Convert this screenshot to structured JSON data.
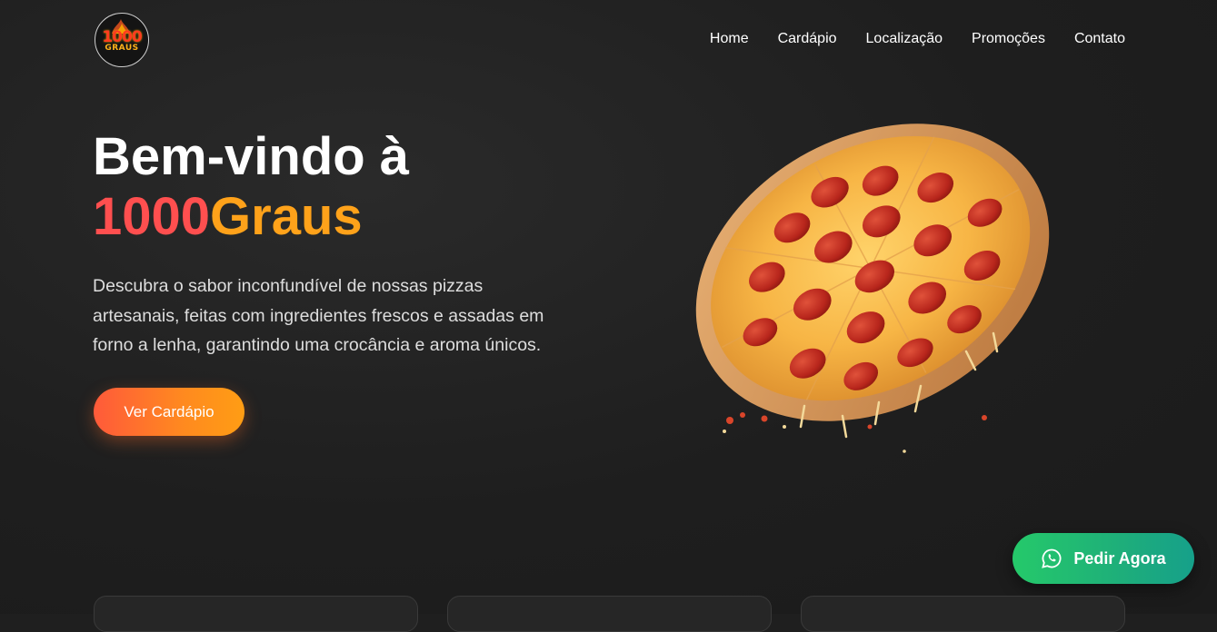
{
  "header": {
    "logo": {
      "number": "1000",
      "word": "GRAUS"
    },
    "nav": [
      "Home",
      "Cardápio",
      "Localização",
      "Promoções",
      "Contato"
    ]
  },
  "hero": {
    "title_line1": "Bem-vindo à",
    "brand_part1": "1000",
    "brand_part2": "Graus",
    "description": "Descubra o sabor inconfundível de nossas pizzas artesanais, feitas com ingredientes frescos e assadas em forno a lenha, garantindo uma crocância e aroma únicos.",
    "cta_label": "Ver Cardápio"
  },
  "floating_button": {
    "label": "Pedir Agora",
    "icon": "whatsapp-icon"
  },
  "cards": [
    {
      "name": "feature-card-1"
    },
    {
      "name": "feature-card-2"
    },
    {
      "name": "feature-card-3"
    }
  ],
  "colors": {
    "background": "#1f1f1f",
    "brand_red": "#ff4f4f",
    "brand_orange": "#ffa21a",
    "cta_gradient": [
      "#ff5a3a",
      "#ff9d14"
    ],
    "whatsapp_gradient": [
      "#25c96a",
      "#16a08a"
    ]
  }
}
